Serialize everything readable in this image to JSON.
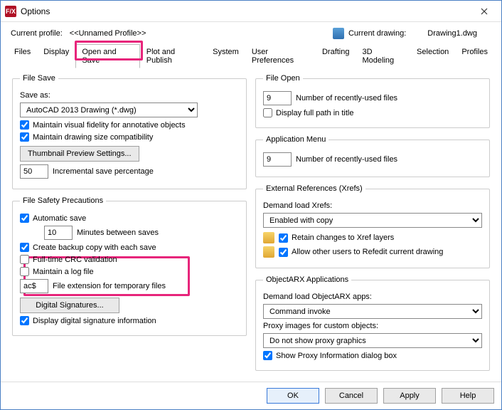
{
  "window": {
    "title": "Options"
  },
  "profile": {
    "label": "Current profile:",
    "value": "<<Unnamed Profile>>",
    "drawing_label": "Current drawing:",
    "drawing_value": "Drawing1.dwg"
  },
  "tabs": {
    "files": "Files",
    "display": "Display",
    "open_save": "Open and Save",
    "plot": "Plot and Publish",
    "system": "System",
    "user_pref": "User Preferences",
    "drafting": "Drafting",
    "modeling": "3D Modeling",
    "selection": "Selection",
    "profiles": "Profiles"
  },
  "file_save": {
    "legend": "File Save",
    "save_as_label": "Save as:",
    "save_as_value": "AutoCAD 2013 Drawing (*.dwg)",
    "maintain_visual": "Maintain visual fidelity for annotative objects",
    "maintain_size": "Maintain drawing size compatibility",
    "thumb_btn": "Thumbnail Preview Settings...",
    "incr_value": "50",
    "incr_label": "Incremental save percentage"
  },
  "file_safety": {
    "legend": "File Safety Precautions",
    "auto_save": "Automatic save",
    "minutes_value": "10",
    "minutes_label": "Minutes between saves",
    "backup": "Create backup copy with each save",
    "crc": "Full-time CRC validation",
    "log": "Maintain a log file",
    "ext_value": "ac$",
    "ext_label": "File extension for temporary files",
    "sig_btn": "Digital Signatures...",
    "disp_sig": "Display digital signature information"
  },
  "file_open": {
    "legend": "File Open",
    "recent_value": "9",
    "recent_label": "Number of recently-used files",
    "full_path": "Display full path in title"
  },
  "app_menu": {
    "legend": "Application Menu",
    "recent_value": "9",
    "recent_label": "Number of recently-used files"
  },
  "xrefs": {
    "legend": "External References (Xrefs)",
    "demand_label": "Demand load Xrefs:",
    "demand_value": "Enabled with copy",
    "retain": "Retain changes to Xref layers",
    "allow_redit": "Allow other users to Refedit current drawing"
  },
  "arx": {
    "legend": "ObjectARX Applications",
    "demand_label": "Demand load ObjectARX apps:",
    "demand_value": "Command invoke",
    "proxy_label": "Proxy images for custom objects:",
    "proxy_value": "Do not show proxy graphics",
    "show_proxy": "Show Proxy Information dialog box"
  },
  "buttons": {
    "ok": "OK",
    "cancel": "Cancel",
    "apply": "Apply",
    "help": "Help"
  }
}
